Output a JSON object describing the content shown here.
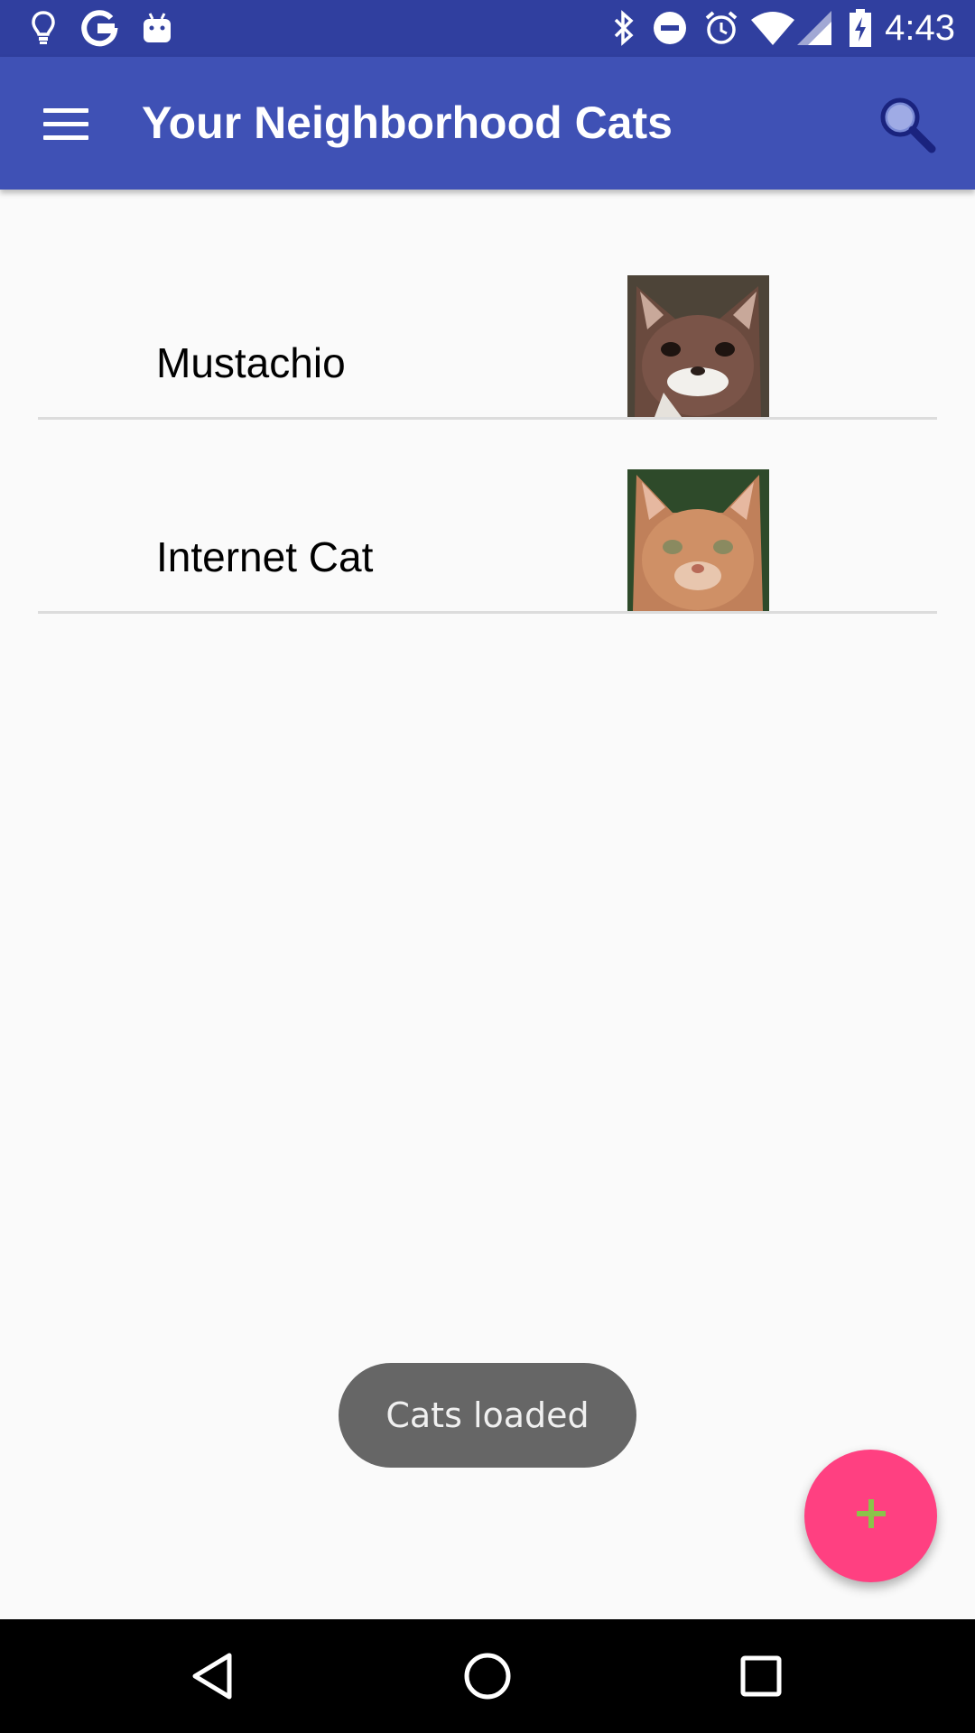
{
  "status_bar": {
    "time": "4:43",
    "icons_left": [
      "lightbulb-icon",
      "google-icon",
      "android-icon"
    ],
    "icons_right": [
      "bluetooth-icon",
      "do-not-disturb-icon",
      "alarm-icon",
      "wifi-icon",
      "cell-signal-icon",
      "battery-charging-icon"
    ]
  },
  "app_bar": {
    "title": "Your Neighborhood Cats",
    "menu_icon": "hamburger-menu-icon",
    "search_icon": "search-icon"
  },
  "cats": [
    {
      "name": "Mustachio",
      "thumbnail": "cat-photo"
    },
    {
      "name": "Internet Cat",
      "thumbnail": "cat-photo"
    }
  ],
  "toast": {
    "text": "Cats loaded"
  },
  "fab": {
    "icon": "plus-icon"
  },
  "nav_bar": {
    "icons": [
      "back-icon",
      "home-icon",
      "recents-icon"
    ]
  },
  "colors": {
    "status_bar": "#303f9f",
    "app_bar": "#3f51b5",
    "fab": "#ff4081",
    "fab_icon": "#8bc34a",
    "toast": "#666666",
    "background": "#fafafa"
  }
}
